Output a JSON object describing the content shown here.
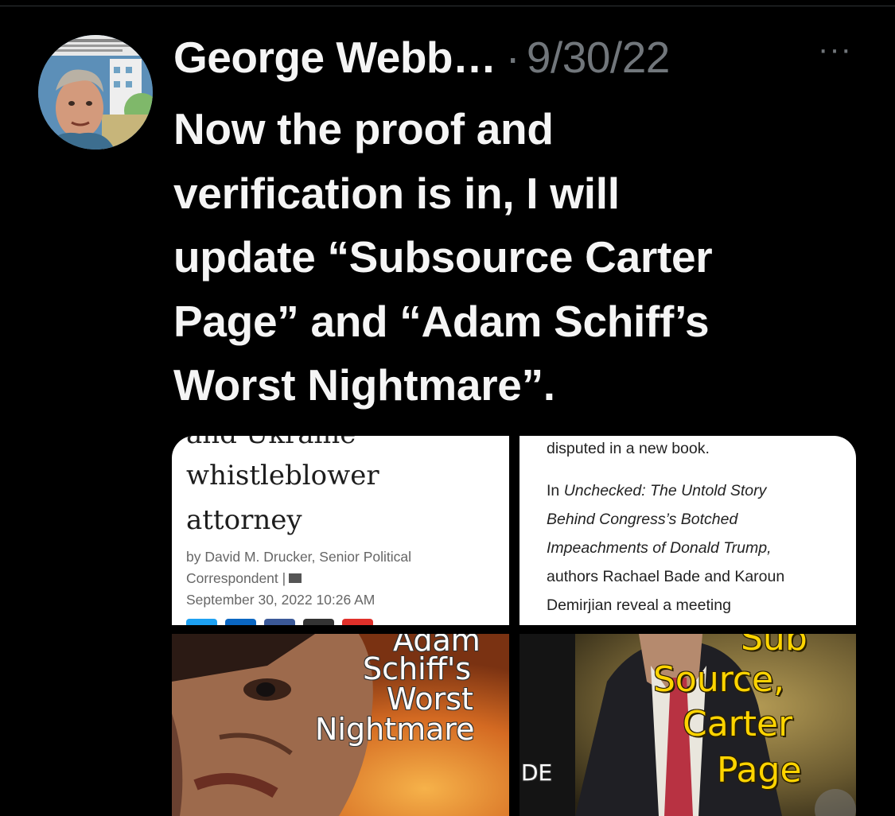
{
  "tweet": {
    "author": "George Webb…",
    "separator": "·",
    "date": "9/30/22",
    "more_icon": "···",
    "text": "Now the proof and\nverification is in, I will\nupdate “Subsource Carter\nPage” and “Adam Schiff’s\nWorst Nightmare”."
  },
  "media": {
    "article1": {
      "cut_text": "and Ukraine",
      "line1": "whistleblower",
      "line2": "attorney",
      "meta1": "by David M. Drucker, Senior Political",
      "meta2": "Correspondent |",
      "meta3": "September 30, 2022 10:26 AM",
      "share_colors": [
        "#1da1f2",
        "#0a66c2",
        "#3b5998",
        "#333333",
        "#e0302a"
      ]
    },
    "article2": {
      "line1": "disputed in a new book.",
      "line2_prefix": "In ",
      "line2_italic": "Unchecked: The Untold Story",
      "line3_italic": "Behind Congress’s Botched",
      "line4_italic": "Impeachments of Donald Trump,",
      "line5": "authors Rachael Bade and Karoun",
      "line6": "Demirjian reveal a meeting"
    },
    "image1": {
      "lines": [
        "Adam",
        "Schiff's",
        "Worst",
        "Nightmare"
      ]
    },
    "image2": {
      "lines": [
        "Sub",
        "Source,",
        "Carter",
        "Page"
      ],
      "side_text": "DE"
    }
  }
}
